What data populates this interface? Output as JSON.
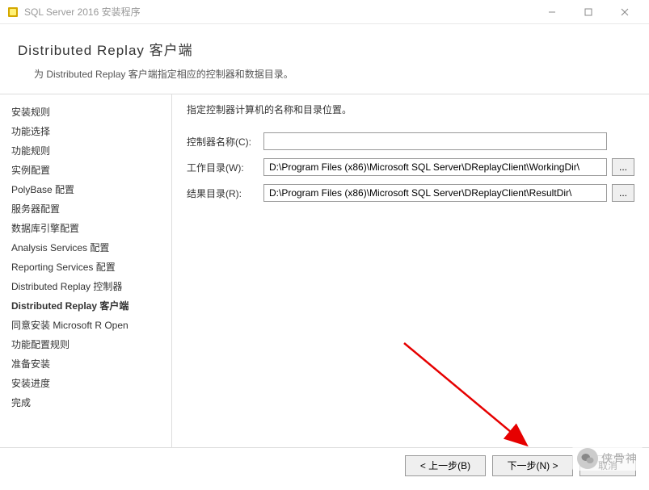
{
  "window": {
    "title": "SQL Server 2016 安装程序"
  },
  "header": {
    "title": "Distributed  Replay 客户端",
    "subtitle": "为 Distributed Replay 客户端指定相应的控制器和数据目录。"
  },
  "sidebar": {
    "items": [
      {
        "label": "安装规则",
        "active": false
      },
      {
        "label": "功能选择",
        "active": false
      },
      {
        "label": "功能规则",
        "active": false
      },
      {
        "label": "实例配置",
        "active": false
      },
      {
        "label": "PolyBase 配置",
        "active": false
      },
      {
        "label": "服务器配置",
        "active": false
      },
      {
        "label": "数据库引擎配置",
        "active": false
      },
      {
        "label": "Analysis Services 配置",
        "active": false
      },
      {
        "label": "Reporting Services 配置",
        "active": false
      },
      {
        "label": "Distributed Replay 控制器",
        "active": false
      },
      {
        "label": "Distributed Replay 客户端",
        "active": true
      },
      {
        "label": "同意安装 Microsoft R Open",
        "active": false
      },
      {
        "label": "功能配置规则",
        "active": false
      },
      {
        "label": "准备安装",
        "active": false
      },
      {
        "label": "安装进度",
        "active": false
      },
      {
        "label": "完成",
        "active": false
      }
    ]
  },
  "main": {
    "instruction": "指定控制器计算机的名称和目录位置。",
    "fields": {
      "controller": {
        "label": "控制器名称(C):",
        "value": ""
      },
      "workdir": {
        "label": "工作目录(W):",
        "value": "D:\\Program Files (x86)\\Microsoft SQL Server\\DReplayClient\\WorkingDir\\"
      },
      "resultdir": {
        "label": "结果目录(R):",
        "value": "D:\\Program Files (x86)\\Microsoft SQL Server\\DReplayClient\\ResultDir\\"
      }
    },
    "browse_label": "..."
  },
  "footer": {
    "back": "< 上一步(B)",
    "next": "下一步(N) >",
    "cancel": "取消"
  },
  "overlay": {
    "wechat_text": "侠骨神"
  }
}
